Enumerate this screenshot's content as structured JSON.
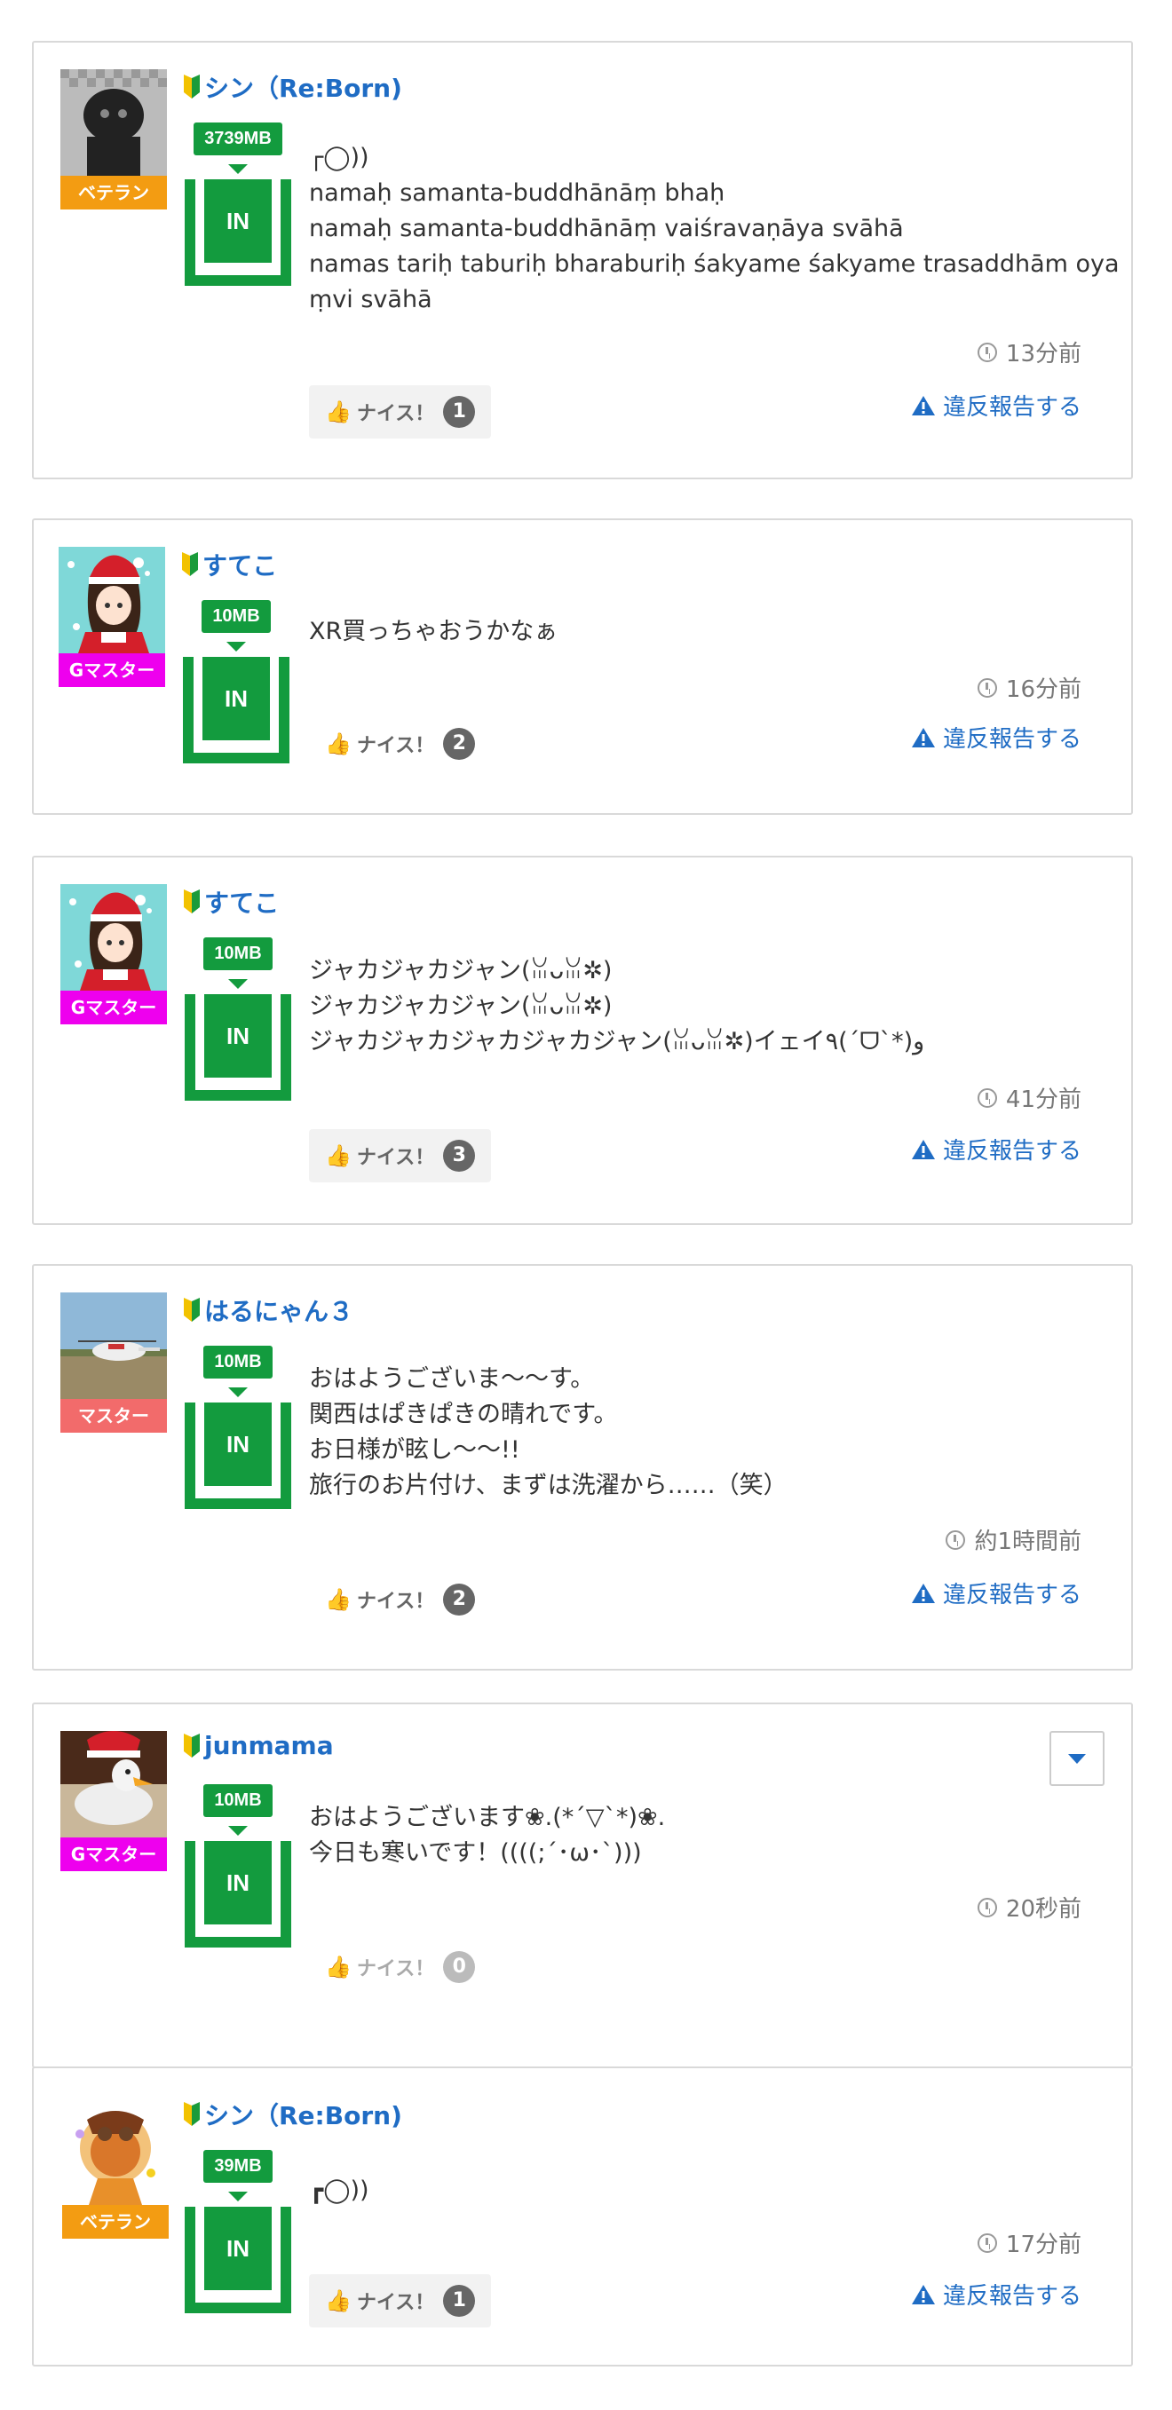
{
  "accent": "#139b3e",
  "link_color": "#1f6cc4",
  "posts": [
    {
      "user": "シン（Re:Born)",
      "rank": "ベテラン",
      "rank_color": "#f39c12",
      "mb": "3739MB",
      "level": "IN",
      "body": "┌◯))\nnamaḥ samanta-buddhānāṃ bhaḥ\nnamaḥ samanta-buddhānāṃ vaiśravaṇāya svāhā\nnamas tariḥ taburiḥ bharaburiḥ śakyame śakyame trasaddhām oya\nṃvi svāhā",
      "time": "13分前",
      "nice_label": "ナイス！",
      "nice_count": "1",
      "report": "違反報告する"
    },
    {
      "user": "すてこ",
      "rank": "Gマスター",
      "rank_color": "#ee00ee",
      "mb": "10MB",
      "level": "IN",
      "body": "XR買っちゃおうかなぁ",
      "time": "16分前",
      "nice_label": "ナイス！",
      "nice_count": "2",
      "report": "違反報告する"
    },
    {
      "user": "すてこ",
      "rank": "Gマスター",
      "rank_color": "#ee00ee",
      "mb": "10MB",
      "level": "IN",
      "body": "ジャカジャカジャン(ꈍᴗꈍ✲)\nジャカジャカジャン(ꈍᴗꈍ✲)\nジャカジャカジャカジャカジャン(ꈍᴗꈍ✲)イェイ٩(´ᗜ`*)و",
      "time": "41分前",
      "nice_label": "ナイス！",
      "nice_count": "3",
      "report": "違反報告する"
    },
    {
      "user": "はるにゃん３",
      "rank": "マスター",
      "rank_color": "#f26b6b",
      "mb": "10MB",
      "level": "IN",
      "body": "おはようございま〜〜す。\n関西はぱきぱきの晴れです。\nお日様が眩し〜〜!!\n旅行のお片付け、まずは洗濯から……（笑）",
      "time": "約1時間前",
      "nice_label": "ナイス！",
      "nice_count": "2",
      "report": "違反報告する"
    },
    {
      "user": "junmama",
      "rank": "Gマスター",
      "rank_color": "#ee00ee",
      "mb": "10MB",
      "level": "IN",
      "body": "おはようございます❀.(*´▽`*)❀.\n今日も寒いです！((((;´･ω･`)))",
      "time": "20秒前",
      "nice_label": "ナイス！",
      "nice_count": "0"
    },
    {
      "user": "シン（Re:Born)",
      "rank": "ベテラン",
      "rank_color": "#f39c12",
      "mb": "39MB",
      "level": "IN",
      "body": "┏◯))",
      "time": "17分前",
      "nice_label": "ナイス！",
      "nice_count": "1",
      "report": "違反報告する"
    }
  ]
}
